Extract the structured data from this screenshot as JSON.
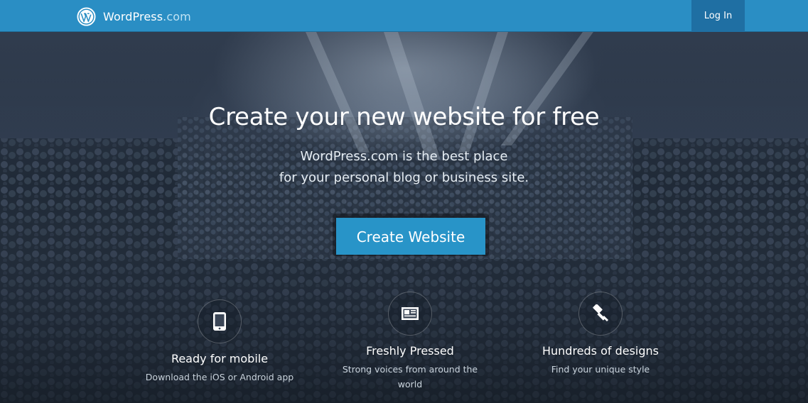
{
  "header": {
    "brand_name": "WordPress",
    "brand_tld": ".com",
    "login_label": "Log In"
  },
  "hero": {
    "headline": "Create your new website for free",
    "subline_1": "WordPress.com is the best place",
    "subline_2": "for your personal blog or business site.",
    "cta_label": "Create Website"
  },
  "features": [
    {
      "icon": "mobile-phone-icon",
      "title": "Ready for mobile",
      "description": "Download the iOS or Android app"
    },
    {
      "icon": "newspaper-icon",
      "title": "Freshly Pressed",
      "description": "Strong voices from around the world"
    },
    {
      "icon": "paint-brush-icon",
      "title": "Hundreds of designs",
      "description": "Find your unique style"
    }
  ],
  "colors": {
    "topbar": "#2a8ec4",
    "login_bg": "#1f6fa3",
    "cta": "#2894c8"
  }
}
